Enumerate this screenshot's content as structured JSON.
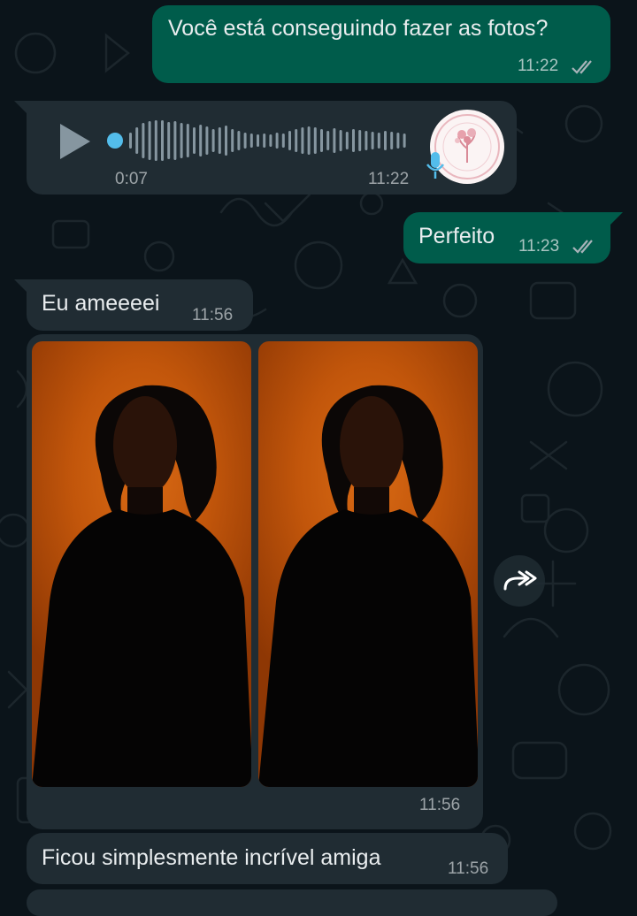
{
  "messages": [
    {
      "id": "m1",
      "direction": "outgoing",
      "type": "text",
      "text": "Você está conseguindo fazer as fotos?",
      "time": "11:22",
      "status": "read"
    },
    {
      "id": "m2",
      "direction": "incoming",
      "type": "voice",
      "duration": "0:07",
      "time": "11:22",
      "played_fraction": 0.02
    },
    {
      "id": "m3",
      "direction": "outgoing",
      "type": "text",
      "text": "Perfeito",
      "time": "11:23",
      "status": "read"
    },
    {
      "id": "m4",
      "direction": "incoming",
      "type": "text",
      "text": "Eu ameeeei",
      "time": "11:56"
    },
    {
      "id": "m5",
      "direction": "incoming",
      "type": "image-album",
      "image_count": 2,
      "time": "11:56"
    },
    {
      "id": "m6",
      "direction": "incoming",
      "type": "text",
      "text": "Ficou simplesmente incrível amiga",
      "time": "11:56"
    }
  ],
  "icons": {
    "play": "play-icon",
    "mic": "microphone-icon",
    "read_ticks": "double-check-icon",
    "forward": "forward-icon",
    "avatar": "avatar"
  },
  "colors": {
    "background": "#0b141a",
    "outgoing_bubble": "#005c4b",
    "incoming_bubble": "#202c33",
    "read_ticks": "#8696a0",
    "voice_progress": "#53bdeb",
    "photo_background": "#c2560b"
  }
}
